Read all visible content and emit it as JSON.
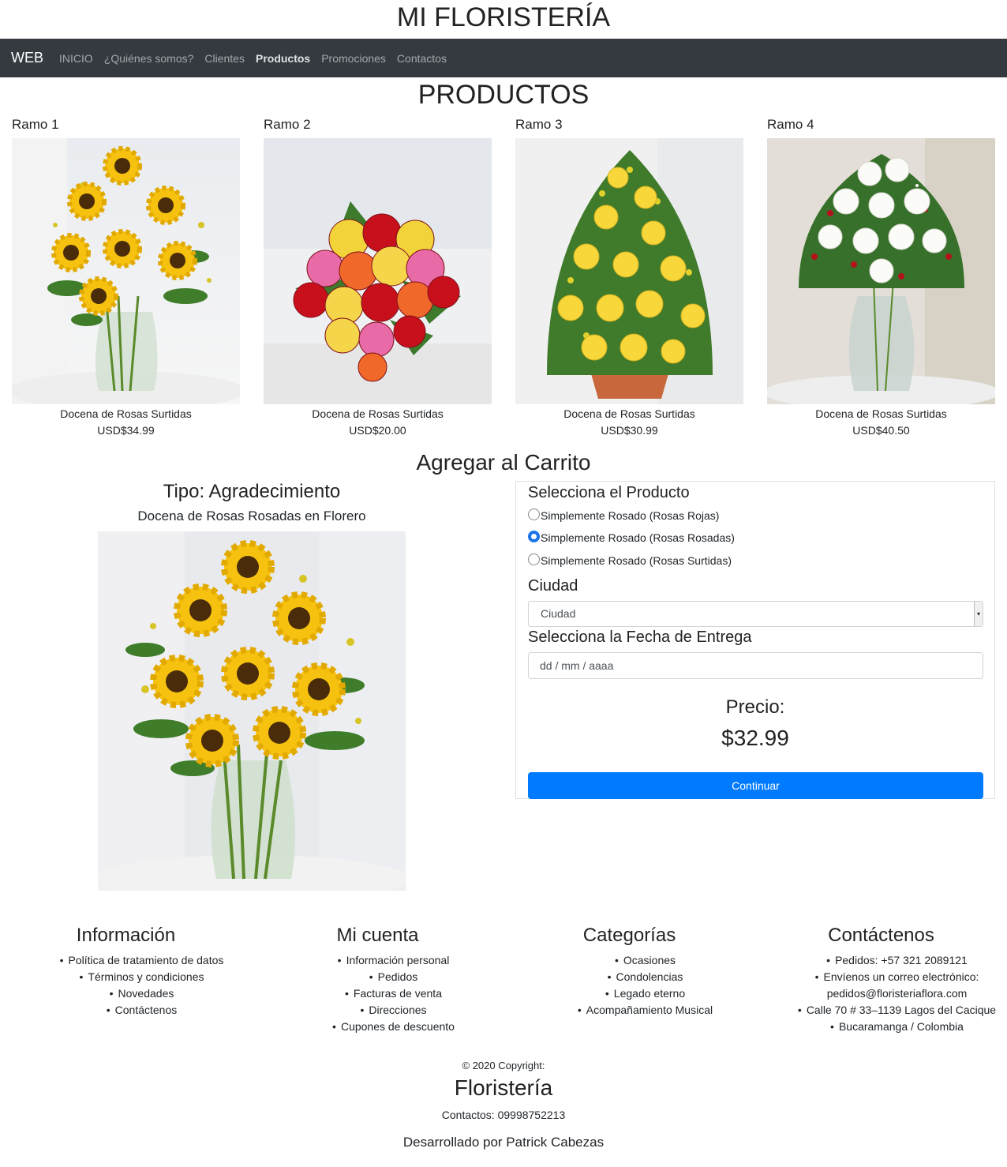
{
  "header": {
    "title": "MI FLORISTERÍA"
  },
  "navbar": {
    "brand": "WEB",
    "links": [
      "INICIO",
      "¿Quiénes somos?",
      "Clientes",
      "Productos",
      "Promociones",
      "Contactos"
    ],
    "active": "Productos"
  },
  "products": {
    "title": "PRODUCTOS",
    "items": [
      {
        "name": "Ramo 1",
        "description": "Docena de Rosas Surtidas",
        "price": "USD$34.99",
        "image": "sunflower-bouquet"
      },
      {
        "name": "Ramo 2",
        "description": "Docena de Rosas Surtidas",
        "price": "USD$20.00",
        "image": "mixed-roses-bouquet"
      },
      {
        "name": "Ramo 3",
        "description": "Docena de Rosas Surtidas",
        "price": "USD$30.99",
        "image": "yellow-roses-basket"
      },
      {
        "name": "Ramo 4",
        "description": "Docena de Rosas Surtidas",
        "price": "USD$40.50",
        "image": "white-roses-vase"
      }
    ]
  },
  "cart": {
    "title": "Agregar al Carrito",
    "type_label": "Tipo: Agradecimiento",
    "selected_name": "Docena de Rosas Rosadas en Florero",
    "select_product_label": "Selecciona el Producto",
    "options": [
      {
        "label": "Simplemente Rosado (Rosas Rojas)",
        "checked": false
      },
      {
        "label": "Simplemente Rosado (Rosas Rosadas)",
        "checked": true
      },
      {
        "label": "Simplemente Rosado (Rosas Surtidas)",
        "checked": false
      }
    ],
    "city_label": "Ciudad",
    "city_value": "Ciudad",
    "date_label": "Selecciona la Fecha de Entrega",
    "date_placeholder": "dd / mm / aaaa",
    "price_label": "Precio:",
    "price": "$32.99",
    "continue_label": "Continuar"
  },
  "footer": {
    "columns": [
      {
        "title": "Información",
        "items": [
          "Política de tratamiento de datos",
          "Términos y condiciones",
          "Novedades",
          "Contáctenos"
        ]
      },
      {
        "title": "Mi cuenta",
        "items": [
          "Información personal",
          "Pedidos",
          "Facturas de venta",
          "Direcciones",
          "Cupones de descuento"
        ]
      },
      {
        "title": "Categorías",
        "items": [
          "Ocasiones",
          "Condolencias",
          "Legado eterno",
          "Acompañamiento Musical"
        ]
      },
      {
        "title": "Contáctenos",
        "items": [
          "Pedidos: +57 321 2089121",
          "Envíenos un correo electrónico:",
          "pedidos@floristeriaflora.com",
          "Calle 70 # 33–1139 Lagos del Cacique",
          "Bucaramanga / Colombia"
        ]
      }
    ],
    "copyright": "© 2020 Copyright:",
    "brand": "Floristería",
    "contacts": "Contactos: 09998752213",
    "developer": "Desarrollado por Patrick Cabezas"
  },
  "colors": {
    "navbar": "#343a40",
    "primary": "#007bff",
    "sunflower": "#f5c518",
    "rose-red": "#d0101a",
    "rose-pink": "#ea6fa8"
  }
}
